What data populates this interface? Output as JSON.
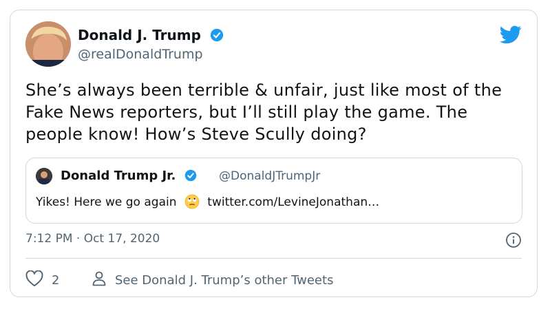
{
  "author": {
    "name": "Donald J. Trump",
    "handle": "@realDonaldTrump",
    "avatar_icon": "profile-photo",
    "verified": true
  },
  "tweet": {
    "text": "She’s always been terrible & unfair, just like most of the Fake News reporters, but I’ll still play the game. The people know! How’s Steve Scully doing?",
    "timestamp": "7:12 PM · Oct 17, 2020"
  },
  "quoted_tweet": {
    "name": "Donald Trump Jr.",
    "handle": "@DonaldJTrumpJr",
    "text_before_emoji": "Yikes! Here we go again",
    "emoji": "face-with-rolling-eyes",
    "link": "twitter.com/LevineJonathan…",
    "verified": true
  },
  "actions": {
    "like_count": "2",
    "other_tweets_label": "See Donald J. Trump’s other Tweets"
  },
  "colors": {
    "brand": "#1d9bf0",
    "secondary_text": "#536471",
    "border": "#cfd9de"
  }
}
